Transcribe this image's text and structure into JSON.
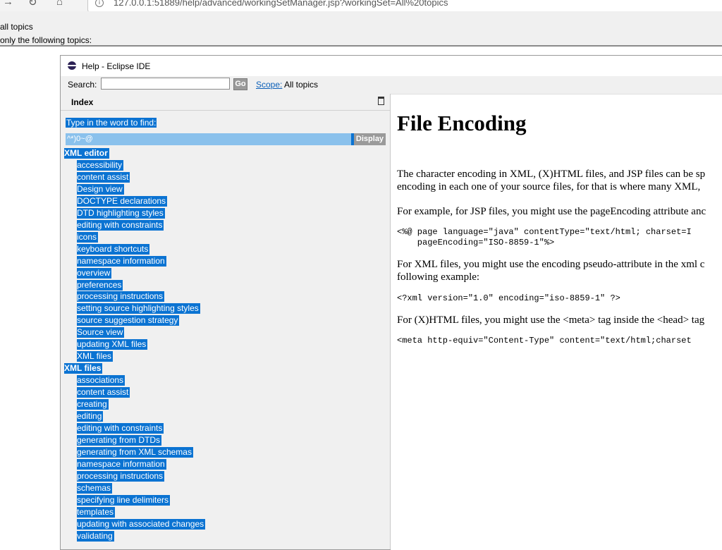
{
  "browser": {
    "url": "127.0.0.1:51889/help/advanced/workingSetManager.jsp?workingSet=All%20topics",
    "info_icon": "info-icon"
  },
  "background_page": {
    "line1": "all topics",
    "line2": "only the following topics:"
  },
  "dialog": {
    "title": "Help - Eclipse IDE",
    "search_label": "Search:",
    "search_value": "",
    "go_label": "Go",
    "scope_link": "Scope:",
    "scope_value": "All topics"
  },
  "index": {
    "header": "Index",
    "find_label": "Type in the word to find:",
    "find_value": "^*)0~@",
    "display_label": "Display",
    "entries": [
      {
        "label": "XML editor",
        "children": [
          "accessibility",
          "content assist",
          "Design view",
          "DOCTYPE declarations",
          "DTD highlighting styles",
          "editing with constraints",
          "icons",
          "keyboard shortcuts",
          "namespace information",
          "overview",
          "preferences",
          "processing instructions",
          "setting source highlighting styles",
          "source suggestion strategy",
          "Source view",
          "updating XML files",
          "XML files"
        ]
      },
      {
        "label": "XML files",
        "children": [
          "associations",
          "content assist",
          "creating",
          "editing",
          "editing with constraints",
          "generating from DTDs",
          "generating from XML schemas",
          "namespace information",
          "processing instructions",
          "schemas",
          "specifying line delimiters",
          "templates",
          "updating with associated changes",
          "validating"
        ]
      }
    ]
  },
  "document": {
    "title": "File Encoding",
    "p1_line1": "The character encoding in XML, (X)HTML files, and JSP files can be sp",
    "p1_line2": "encoding in each one of your source files, for that is where many XML,",
    "p2": "For example, for JSP files, you might use the pageEncoding attribute anc",
    "code1_line1": "<%@ page language=\"java\" contentType=\"text/html; charset=I",
    "code1_line2": "    pageEncoding=\"ISO-8859-1\"%>",
    "p3_line1": "For XML files, you might use the encoding pseudo-attribute in the xml c",
    "p3_line2": "following example:",
    "code2": "<?xml version=\"1.0\" encoding=\"iso-8859-1\" ?>",
    "p4": "For (X)HTML files, you might use the <meta> tag inside the <head> tag",
    "code3": "<meta http-equiv=\"Content-Type\" content=\"text/html;charset"
  }
}
